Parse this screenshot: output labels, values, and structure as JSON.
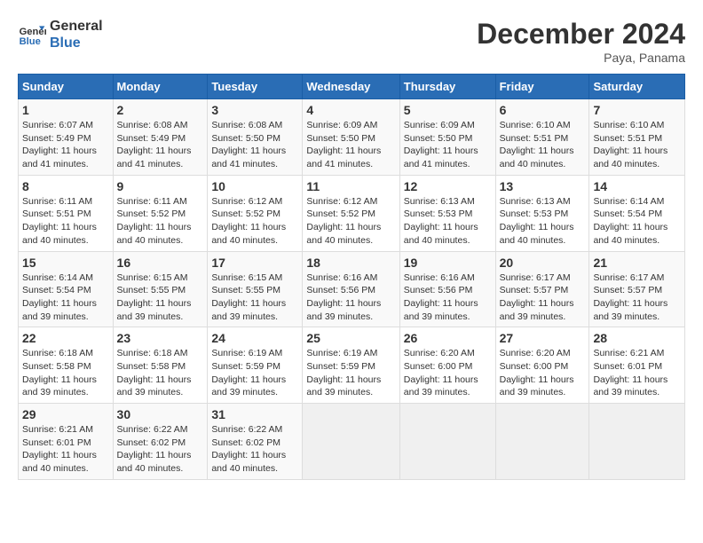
{
  "header": {
    "logo_line1": "General",
    "logo_line2": "Blue",
    "month_title": "December 2024",
    "location": "Paya, Panama"
  },
  "days_of_week": [
    "Sunday",
    "Monday",
    "Tuesday",
    "Wednesday",
    "Thursday",
    "Friday",
    "Saturday"
  ],
  "weeks": [
    [
      {
        "day": "1",
        "sunrise": "6:07 AM",
        "sunset": "5:49 PM",
        "daylight": "11 hours and 41 minutes."
      },
      {
        "day": "2",
        "sunrise": "6:08 AM",
        "sunset": "5:49 PM",
        "daylight": "11 hours and 41 minutes."
      },
      {
        "day": "3",
        "sunrise": "6:08 AM",
        "sunset": "5:50 PM",
        "daylight": "11 hours and 41 minutes."
      },
      {
        "day": "4",
        "sunrise": "6:09 AM",
        "sunset": "5:50 PM",
        "daylight": "11 hours and 41 minutes."
      },
      {
        "day": "5",
        "sunrise": "6:09 AM",
        "sunset": "5:50 PM",
        "daylight": "11 hours and 41 minutes."
      },
      {
        "day": "6",
        "sunrise": "6:10 AM",
        "sunset": "5:51 PM",
        "daylight": "11 hours and 40 minutes."
      },
      {
        "day": "7",
        "sunrise": "6:10 AM",
        "sunset": "5:51 PM",
        "daylight": "11 hours and 40 minutes."
      }
    ],
    [
      {
        "day": "8",
        "sunrise": "6:11 AM",
        "sunset": "5:51 PM",
        "daylight": "11 hours and 40 minutes."
      },
      {
        "day": "9",
        "sunrise": "6:11 AM",
        "sunset": "5:52 PM",
        "daylight": "11 hours and 40 minutes."
      },
      {
        "day": "10",
        "sunrise": "6:12 AM",
        "sunset": "5:52 PM",
        "daylight": "11 hours and 40 minutes."
      },
      {
        "day": "11",
        "sunrise": "6:12 AM",
        "sunset": "5:52 PM",
        "daylight": "11 hours and 40 minutes."
      },
      {
        "day": "12",
        "sunrise": "6:13 AM",
        "sunset": "5:53 PM",
        "daylight": "11 hours and 40 minutes."
      },
      {
        "day": "13",
        "sunrise": "6:13 AM",
        "sunset": "5:53 PM",
        "daylight": "11 hours and 40 minutes."
      },
      {
        "day": "14",
        "sunrise": "6:14 AM",
        "sunset": "5:54 PM",
        "daylight": "11 hours and 40 minutes."
      }
    ],
    [
      {
        "day": "15",
        "sunrise": "6:14 AM",
        "sunset": "5:54 PM",
        "daylight": "11 hours and 39 minutes."
      },
      {
        "day": "16",
        "sunrise": "6:15 AM",
        "sunset": "5:55 PM",
        "daylight": "11 hours and 39 minutes."
      },
      {
        "day": "17",
        "sunrise": "6:15 AM",
        "sunset": "5:55 PM",
        "daylight": "11 hours and 39 minutes."
      },
      {
        "day": "18",
        "sunrise": "6:16 AM",
        "sunset": "5:56 PM",
        "daylight": "11 hours and 39 minutes."
      },
      {
        "day": "19",
        "sunrise": "6:16 AM",
        "sunset": "5:56 PM",
        "daylight": "11 hours and 39 minutes."
      },
      {
        "day": "20",
        "sunrise": "6:17 AM",
        "sunset": "5:57 PM",
        "daylight": "11 hours and 39 minutes."
      },
      {
        "day": "21",
        "sunrise": "6:17 AM",
        "sunset": "5:57 PM",
        "daylight": "11 hours and 39 minutes."
      }
    ],
    [
      {
        "day": "22",
        "sunrise": "6:18 AM",
        "sunset": "5:58 PM",
        "daylight": "11 hours and 39 minutes."
      },
      {
        "day": "23",
        "sunrise": "6:18 AM",
        "sunset": "5:58 PM",
        "daylight": "11 hours and 39 minutes."
      },
      {
        "day": "24",
        "sunrise": "6:19 AM",
        "sunset": "5:59 PM",
        "daylight": "11 hours and 39 minutes."
      },
      {
        "day": "25",
        "sunrise": "6:19 AM",
        "sunset": "5:59 PM",
        "daylight": "11 hours and 39 minutes."
      },
      {
        "day": "26",
        "sunrise": "6:20 AM",
        "sunset": "6:00 PM",
        "daylight": "11 hours and 39 minutes."
      },
      {
        "day": "27",
        "sunrise": "6:20 AM",
        "sunset": "6:00 PM",
        "daylight": "11 hours and 39 minutes."
      },
      {
        "day": "28",
        "sunrise": "6:21 AM",
        "sunset": "6:01 PM",
        "daylight": "11 hours and 39 minutes."
      }
    ],
    [
      {
        "day": "29",
        "sunrise": "6:21 AM",
        "sunset": "6:01 PM",
        "daylight": "11 hours and 40 minutes."
      },
      {
        "day": "30",
        "sunrise": "6:22 AM",
        "sunset": "6:02 PM",
        "daylight": "11 hours and 40 minutes."
      },
      {
        "day": "31",
        "sunrise": "6:22 AM",
        "sunset": "6:02 PM",
        "daylight": "11 hours and 40 minutes."
      },
      null,
      null,
      null,
      null
    ]
  ],
  "labels": {
    "sunrise": "Sunrise:",
    "sunset": "Sunset:",
    "daylight": "Daylight:"
  }
}
